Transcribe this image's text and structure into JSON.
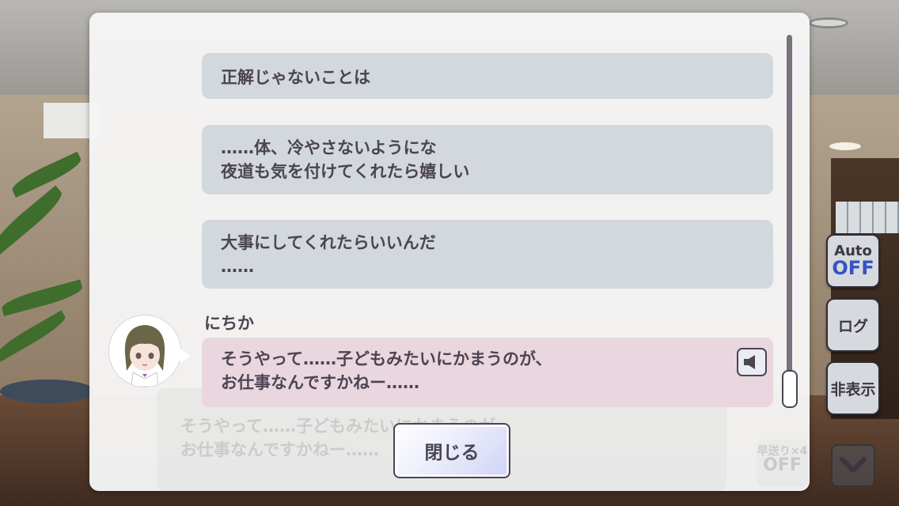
{
  "dialog_log": {
    "entries": [
      {
        "lines": [
          "正解じゃないことは"
        ]
      },
      {
        "lines": [
          "……体、冷やさないようにな",
          "夜道も気を付けてくれたら嬉しい"
        ]
      },
      {
        "lines": [
          "大事にしてくれたらいいんだ",
          "……"
        ]
      }
    ],
    "current": {
      "speaker": "にちか",
      "lines": [
        "そうやって……子どもみたいにかまうのが、",
        "お仕事なんですかねー……"
      ],
      "voice_icon": "speaker-icon"
    },
    "close_label": "閉じる"
  },
  "background_textbox": {
    "lines": [
      "そうやって……子どもみたいにかまうのが、",
      "お仕事なんですかねー……"
    ],
    "skip_label": "早送り×4",
    "skip_value": "OFF"
  },
  "side_controls": {
    "auto_label": "Auto",
    "auto_value": "OFF",
    "log_label": "ログ",
    "hide_label": "非表示",
    "down_icon": "chevron-down-icon"
  },
  "colors": {
    "text": "#4b4453",
    "entry_bg": "#d3d8dd",
    "current_bg": "#ead6df",
    "auto_off": "#3653c4"
  }
}
